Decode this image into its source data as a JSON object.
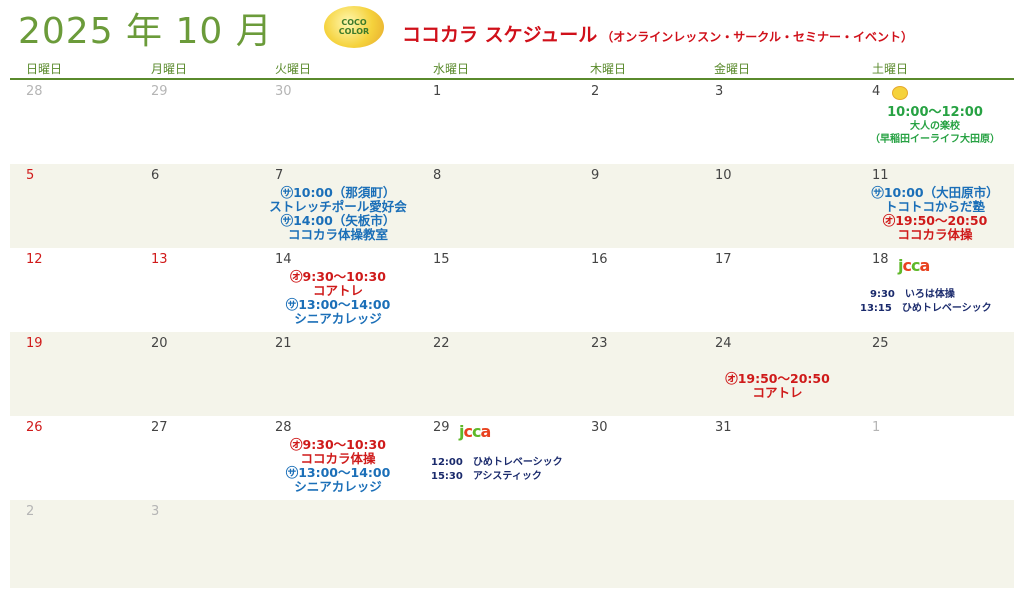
{
  "header": {
    "title": "2025 年 10 月",
    "logo_text_top": "COCO",
    "logo_text_bottom": "COLOR",
    "schedule_title": "ココカラ スケジュール",
    "schedule_subtitle": "（オンラインレッスン・サークル・セミナー・イベント）"
  },
  "weekdays": [
    "日曜日",
    "月曜日",
    "火曜日",
    "水曜日",
    "木曜日",
    "金曜日",
    "土曜日"
  ],
  "weeks": [
    {
      "days": [
        "28",
        "29",
        "30",
        "1",
        "2",
        "3",
        "4"
      ]
    },
    {
      "days": [
        "5",
        "6",
        "7",
        "8",
        "9",
        "10",
        "11"
      ]
    },
    {
      "days": [
        "12",
        "13",
        "14",
        "15",
        "16",
        "17",
        "18"
      ]
    },
    {
      "days": [
        "19",
        "20",
        "21",
        "22",
        "23",
        "24",
        "25"
      ]
    },
    {
      "days": [
        "26",
        "27",
        "28",
        "29",
        "30",
        "31",
        "1"
      ]
    },
    {
      "days": [
        "2",
        "3",
        "",
        "",
        "",
        "",
        ""
      ]
    }
  ],
  "events": {
    "oct4": [
      "10:00〜12:00",
      "大人の楽校",
      "（早稲田イーライフ大田原）"
    ],
    "oct7": [
      "㋚10:00（那須町）",
      "ストレッチポール愛好会",
      "㋚14:00（矢板市）",
      "ココカラ体操教室"
    ],
    "oct11": [
      "㋚10:00（大田原市）",
      "トコトコからだ塾",
      "㋔19:50〜20:50",
      "ココカラ体操"
    ],
    "oct14": [
      "㋔9:30〜10:30",
      "コアトレ",
      "㋚13:00〜14:00",
      "シニアカレッジ"
    ],
    "oct18_logo": "jcca",
    "oct18": [
      "9:30　いろは体操",
      "13:15　ひめトレベーシック"
    ],
    "oct24": [
      "㋔19:50〜20:50",
      "コアトレ"
    ],
    "oct28": [
      "㋔9:30〜10:30",
      "ココカラ体操",
      "㋚13:00〜14:00",
      "シニアカレッジ"
    ],
    "oct29_logo": "jcca",
    "oct29": [
      "12:00　ひめトレベーシック",
      "15:30　アシスティック"
    ]
  },
  "colors": {
    "accent_green": "#6b9b3a",
    "title_red": "#d0101a",
    "event_blue": "#1b6fb8",
    "event_red": "#cf1a1a",
    "event_green": "#27a243",
    "alt_row": "#f4f4ea"
  }
}
